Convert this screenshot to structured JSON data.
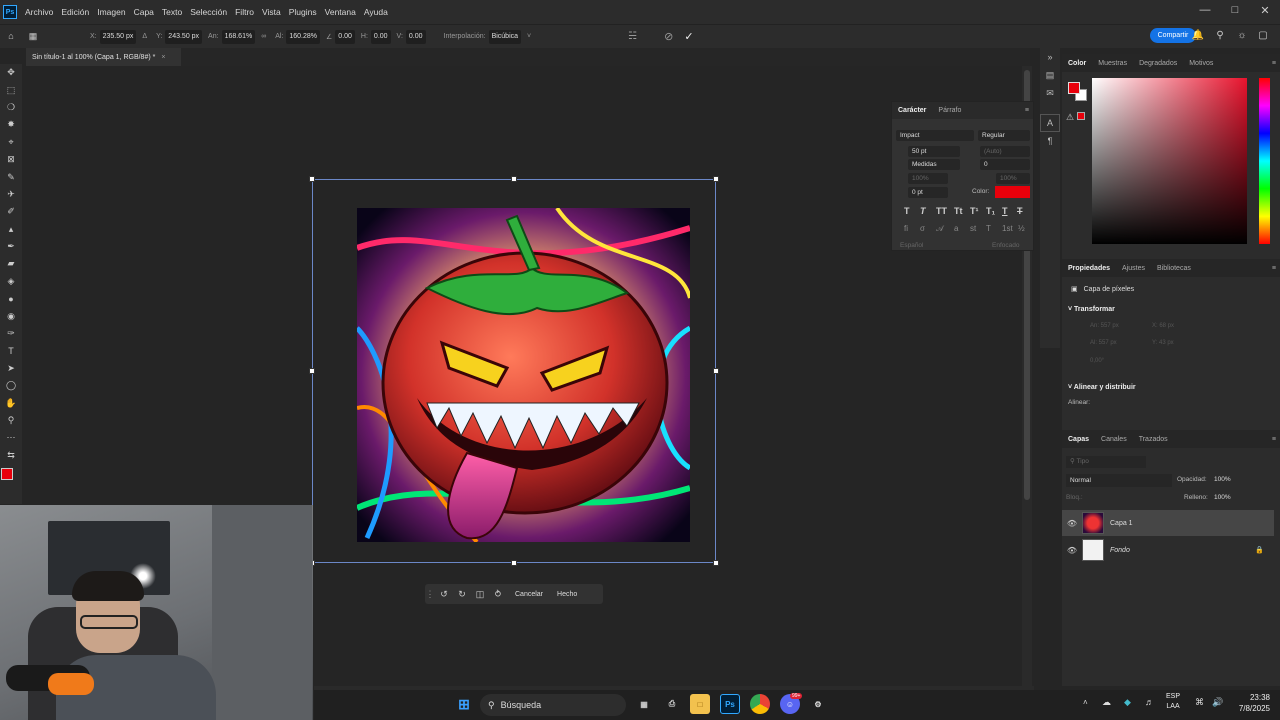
{
  "app": {
    "logo": "Ps"
  },
  "menu": [
    "Archivo",
    "Edición",
    "Imagen",
    "Capa",
    "Texto",
    "Selección",
    "Filtro",
    "Vista",
    "Plugins",
    "Ventana",
    "Ayuda"
  ],
  "options": {
    "x_label": "X:",
    "x_value": "235.50 px",
    "y_label": "Y:",
    "y_value": "243.50 px",
    "w_label": "An:",
    "w_value": "168.61%",
    "h_label": "Al:",
    "h_value": "160.28%",
    "angle_value": "0.00",
    "hskew_label": "H:",
    "hskew_value": "0.00",
    "vskew_label": "V:",
    "vskew_value": "0.00",
    "interp_label": "Interpolación:",
    "interp_value": "Bicúbica"
  },
  "share_label": "Compartir",
  "doc_tab": {
    "title": "Sin título-1 al 100% (Capa 1, RGB/8#) *",
    "close": "×"
  },
  "transform_bar": {
    "cancel": "Cancelar",
    "done": "Hecho"
  },
  "character": {
    "tabs": [
      "Carácter",
      "Párrafo"
    ],
    "font": "Impact",
    "style": "Regular",
    "size": "50 pt",
    "leading": "(Auto)",
    "kerning": "Medidas",
    "tracking": "0",
    "vscale": "100%",
    "hscale": "100%",
    "baseline": "0 pt",
    "color_label": "Color:",
    "text_color": "#e8000b",
    "language": "Español",
    "aa": "Enfocado"
  },
  "color_panel": {
    "tabs": [
      "Color",
      "Muestras",
      "Degradados",
      "Motivos"
    ],
    "fg": "#e8000b",
    "bg": "#ffffff"
  },
  "properties": {
    "tabs": [
      "Propiedades",
      "Ajustes",
      "Bibliotecas"
    ],
    "layer_type": "Capa de píxeles",
    "transform": "Transformar",
    "an": "An: 557 px",
    "x": "X: 68 px",
    "al": "Al: 557 px",
    "y": "Y: 43 px",
    "angle": "0,00°",
    "align": "Alinear y distribuir",
    "align_sub": "Alinear:"
  },
  "layers": {
    "tabs": [
      "Capas",
      "Canales",
      "Trazados"
    ],
    "filter": "Tipo",
    "blend": "Normal",
    "opacity_label": "Opacidad:",
    "opacity": "100%",
    "lock_label": "Bloq.:",
    "fill_label": "Relleno:",
    "fill": "100%",
    "items": [
      {
        "name": "Capa 1"
      },
      {
        "name": "Fondo"
      }
    ]
  },
  "taskbar": {
    "search": "Búsqueda",
    "lang1": "ESP",
    "lang2": "LAA",
    "time": "23:38",
    "date": "7/8/2025",
    "notif": "99+"
  }
}
